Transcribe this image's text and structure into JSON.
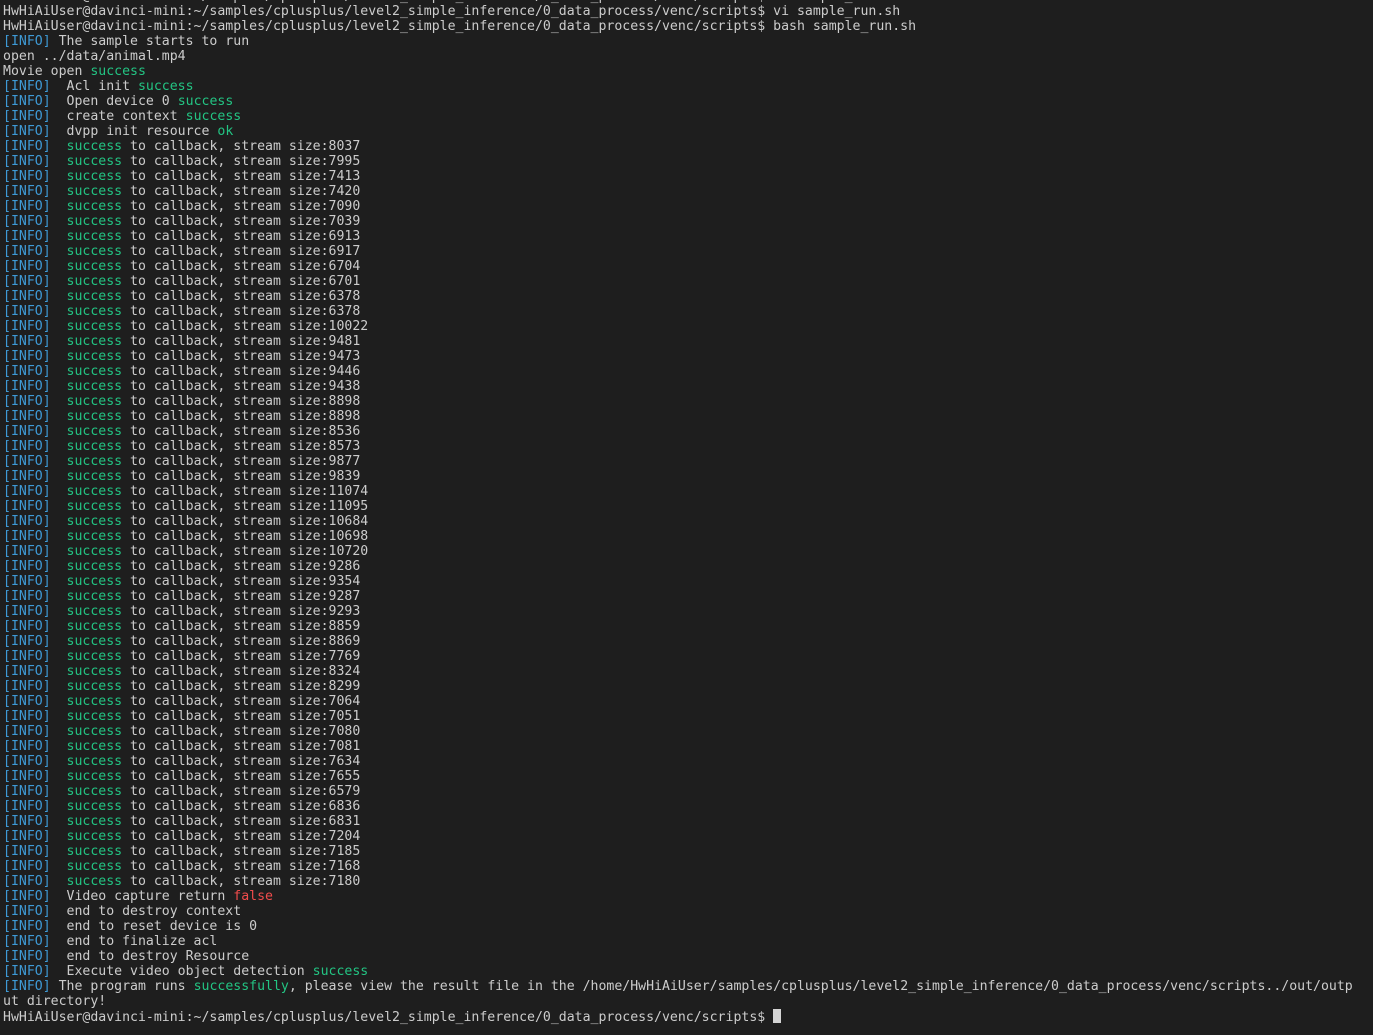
{
  "terminal": {
    "prompt": "HwHiAiUser@davinci-mini:~/samples/cplusplus/level2_simple_inference/0_data_process/venc/scripts$",
    "lines": [
      [
        [
          "plain",
          "HwHiAiUser@davinci-mini:~/samples/cplusplus/level2_simple_inference/0_data_process/venc/scripts$ vi sample_run.sh"
        ]
      ],
      [
        [
          "plain",
          "HwHiAiUser@davinci-mini:~/samples/cplusplus/level2_simple_inference/0_data_process/venc/scripts$ vi sample_run.sh"
        ]
      ],
      [
        [
          "plain",
          "HwHiAiUser@davinci-mini:~/samples/cplusplus/level2_simple_inference/0_data_process/venc/scripts$ bash sample_run.sh"
        ]
      ],
      [
        [
          "tag",
          "[INFO]"
        ],
        [
          "plain",
          " The sample starts to run"
        ]
      ],
      [
        [
          "plain",
          "open ../data/animal.mp4"
        ]
      ],
      [
        [
          "plain",
          "Movie open "
        ],
        [
          "ok",
          "success"
        ]
      ],
      [
        [
          "tag",
          "[INFO]"
        ],
        [
          "plain",
          "  Acl init "
        ],
        [
          "ok",
          "success"
        ]
      ],
      [
        [
          "tag",
          "[INFO]"
        ],
        [
          "plain",
          "  Open device 0 "
        ],
        [
          "ok",
          "success"
        ]
      ],
      [
        [
          "tag",
          "[INFO]"
        ],
        [
          "plain",
          "  create context "
        ],
        [
          "ok",
          "success"
        ]
      ],
      [
        [
          "tag",
          "[INFO]"
        ],
        [
          "plain",
          "  dvpp init resource "
        ],
        [
          "ok",
          "ok"
        ]
      ],
      [
        [
          "tag",
          "[INFO]"
        ],
        [
          "plain",
          "  "
        ],
        [
          "ok",
          "success"
        ],
        [
          "plain",
          " to callback, stream size:8037"
        ]
      ],
      [
        [
          "tag",
          "[INFO]"
        ],
        [
          "plain",
          "  "
        ],
        [
          "ok",
          "success"
        ],
        [
          "plain",
          " to callback, stream size:7995"
        ]
      ],
      [
        [
          "tag",
          "[INFO]"
        ],
        [
          "plain",
          "  "
        ],
        [
          "ok",
          "success"
        ],
        [
          "plain",
          " to callback, stream size:7413"
        ]
      ],
      [
        [
          "tag",
          "[INFO]"
        ],
        [
          "plain",
          "  "
        ],
        [
          "ok",
          "success"
        ],
        [
          "plain",
          " to callback, stream size:7420"
        ]
      ],
      [
        [
          "tag",
          "[INFO]"
        ],
        [
          "plain",
          "  "
        ],
        [
          "ok",
          "success"
        ],
        [
          "plain",
          " to callback, stream size:7090"
        ]
      ],
      [
        [
          "tag",
          "[INFO]"
        ],
        [
          "plain",
          "  "
        ],
        [
          "ok",
          "success"
        ],
        [
          "plain",
          " to callback, stream size:7039"
        ]
      ],
      [
        [
          "tag",
          "[INFO]"
        ],
        [
          "plain",
          "  "
        ],
        [
          "ok",
          "success"
        ],
        [
          "plain",
          " to callback, stream size:6913"
        ]
      ],
      [
        [
          "tag",
          "[INFO]"
        ],
        [
          "plain",
          "  "
        ],
        [
          "ok",
          "success"
        ],
        [
          "plain",
          " to callback, stream size:6917"
        ]
      ],
      [
        [
          "tag",
          "[INFO]"
        ],
        [
          "plain",
          "  "
        ],
        [
          "ok",
          "success"
        ],
        [
          "plain",
          " to callback, stream size:6704"
        ]
      ],
      [
        [
          "tag",
          "[INFO]"
        ],
        [
          "plain",
          "  "
        ],
        [
          "ok",
          "success"
        ],
        [
          "plain",
          " to callback, stream size:6701"
        ]
      ],
      [
        [
          "tag",
          "[INFO]"
        ],
        [
          "plain",
          "  "
        ],
        [
          "ok",
          "success"
        ],
        [
          "plain",
          " to callback, stream size:6378"
        ]
      ],
      [
        [
          "tag",
          "[INFO]"
        ],
        [
          "plain",
          "  "
        ],
        [
          "ok",
          "success"
        ],
        [
          "plain",
          " to callback, stream size:6378"
        ]
      ],
      [
        [
          "tag",
          "[INFO]"
        ],
        [
          "plain",
          "  "
        ],
        [
          "ok",
          "success"
        ],
        [
          "plain",
          " to callback, stream size:10022"
        ]
      ],
      [
        [
          "tag",
          "[INFO]"
        ],
        [
          "plain",
          "  "
        ],
        [
          "ok",
          "success"
        ],
        [
          "plain",
          " to callback, stream size:9481"
        ]
      ],
      [
        [
          "tag",
          "[INFO]"
        ],
        [
          "plain",
          "  "
        ],
        [
          "ok",
          "success"
        ],
        [
          "plain",
          " to callback, stream size:9473"
        ]
      ],
      [
        [
          "tag",
          "[INFO]"
        ],
        [
          "plain",
          "  "
        ],
        [
          "ok",
          "success"
        ],
        [
          "plain",
          " to callback, stream size:9446"
        ]
      ],
      [
        [
          "tag",
          "[INFO]"
        ],
        [
          "plain",
          "  "
        ],
        [
          "ok",
          "success"
        ],
        [
          "plain",
          " to callback, stream size:9438"
        ]
      ],
      [
        [
          "tag",
          "[INFO]"
        ],
        [
          "plain",
          "  "
        ],
        [
          "ok",
          "success"
        ],
        [
          "plain",
          " to callback, stream size:8898"
        ]
      ],
      [
        [
          "tag",
          "[INFO]"
        ],
        [
          "plain",
          "  "
        ],
        [
          "ok",
          "success"
        ],
        [
          "plain",
          " to callback, stream size:8898"
        ]
      ],
      [
        [
          "tag",
          "[INFO]"
        ],
        [
          "plain",
          "  "
        ],
        [
          "ok",
          "success"
        ],
        [
          "plain",
          " to callback, stream size:8536"
        ]
      ],
      [
        [
          "tag",
          "[INFO]"
        ],
        [
          "plain",
          "  "
        ],
        [
          "ok",
          "success"
        ],
        [
          "plain",
          " to callback, stream size:8573"
        ]
      ],
      [
        [
          "tag",
          "[INFO]"
        ],
        [
          "plain",
          "  "
        ],
        [
          "ok",
          "success"
        ],
        [
          "plain",
          " to callback, stream size:9877"
        ]
      ],
      [
        [
          "tag",
          "[INFO]"
        ],
        [
          "plain",
          "  "
        ],
        [
          "ok",
          "success"
        ],
        [
          "plain",
          " to callback, stream size:9839"
        ]
      ],
      [
        [
          "tag",
          "[INFO]"
        ],
        [
          "plain",
          "  "
        ],
        [
          "ok",
          "success"
        ],
        [
          "plain",
          " to callback, stream size:11074"
        ]
      ],
      [
        [
          "tag",
          "[INFO]"
        ],
        [
          "plain",
          "  "
        ],
        [
          "ok",
          "success"
        ],
        [
          "plain",
          " to callback, stream size:11095"
        ]
      ],
      [
        [
          "tag",
          "[INFO]"
        ],
        [
          "plain",
          "  "
        ],
        [
          "ok",
          "success"
        ],
        [
          "plain",
          " to callback, stream size:10684"
        ]
      ],
      [
        [
          "tag",
          "[INFO]"
        ],
        [
          "plain",
          "  "
        ],
        [
          "ok",
          "success"
        ],
        [
          "plain",
          " to callback, stream size:10698"
        ]
      ],
      [
        [
          "tag",
          "[INFO]"
        ],
        [
          "plain",
          "  "
        ],
        [
          "ok",
          "success"
        ],
        [
          "plain",
          " to callback, stream size:10720"
        ]
      ],
      [
        [
          "tag",
          "[INFO]"
        ],
        [
          "plain",
          "  "
        ],
        [
          "ok",
          "success"
        ],
        [
          "plain",
          " to callback, stream size:9286"
        ]
      ],
      [
        [
          "tag",
          "[INFO]"
        ],
        [
          "plain",
          "  "
        ],
        [
          "ok",
          "success"
        ],
        [
          "plain",
          " to callback, stream size:9354"
        ]
      ],
      [
        [
          "tag",
          "[INFO]"
        ],
        [
          "plain",
          "  "
        ],
        [
          "ok",
          "success"
        ],
        [
          "plain",
          " to callback, stream size:9287"
        ]
      ],
      [
        [
          "tag",
          "[INFO]"
        ],
        [
          "plain",
          "  "
        ],
        [
          "ok",
          "success"
        ],
        [
          "plain",
          " to callback, stream size:9293"
        ]
      ],
      [
        [
          "tag",
          "[INFO]"
        ],
        [
          "plain",
          "  "
        ],
        [
          "ok",
          "success"
        ],
        [
          "plain",
          " to callback, stream size:8859"
        ]
      ],
      [
        [
          "tag",
          "[INFO]"
        ],
        [
          "plain",
          "  "
        ],
        [
          "ok",
          "success"
        ],
        [
          "plain",
          " to callback, stream size:8869"
        ]
      ],
      [
        [
          "tag",
          "[INFO]"
        ],
        [
          "plain",
          "  "
        ],
        [
          "ok",
          "success"
        ],
        [
          "plain",
          " to callback, stream size:7769"
        ]
      ],
      [
        [
          "tag",
          "[INFO]"
        ],
        [
          "plain",
          "  "
        ],
        [
          "ok",
          "success"
        ],
        [
          "plain",
          " to callback, stream size:8324"
        ]
      ],
      [
        [
          "tag",
          "[INFO]"
        ],
        [
          "plain",
          "  "
        ],
        [
          "ok",
          "success"
        ],
        [
          "plain",
          " to callback, stream size:8299"
        ]
      ],
      [
        [
          "tag",
          "[INFO]"
        ],
        [
          "plain",
          "  "
        ],
        [
          "ok",
          "success"
        ],
        [
          "plain",
          " to callback, stream size:7064"
        ]
      ],
      [
        [
          "tag",
          "[INFO]"
        ],
        [
          "plain",
          "  "
        ],
        [
          "ok",
          "success"
        ],
        [
          "plain",
          " to callback, stream size:7051"
        ]
      ],
      [
        [
          "tag",
          "[INFO]"
        ],
        [
          "plain",
          "  "
        ],
        [
          "ok",
          "success"
        ],
        [
          "plain",
          " to callback, stream size:7080"
        ]
      ],
      [
        [
          "tag",
          "[INFO]"
        ],
        [
          "plain",
          "  "
        ],
        [
          "ok",
          "success"
        ],
        [
          "plain",
          " to callback, stream size:7081"
        ]
      ],
      [
        [
          "tag",
          "[INFO]"
        ],
        [
          "plain",
          "  "
        ],
        [
          "ok",
          "success"
        ],
        [
          "plain",
          " to callback, stream size:7634"
        ]
      ],
      [
        [
          "tag",
          "[INFO]"
        ],
        [
          "plain",
          "  "
        ],
        [
          "ok",
          "success"
        ],
        [
          "plain",
          " to callback, stream size:7655"
        ]
      ],
      [
        [
          "tag",
          "[INFO]"
        ],
        [
          "plain",
          "  "
        ],
        [
          "ok",
          "success"
        ],
        [
          "plain",
          " to callback, stream size:6579"
        ]
      ],
      [
        [
          "tag",
          "[INFO]"
        ],
        [
          "plain",
          "  "
        ],
        [
          "ok",
          "success"
        ],
        [
          "plain",
          " to callback, stream size:6836"
        ]
      ],
      [
        [
          "tag",
          "[INFO]"
        ],
        [
          "plain",
          "  "
        ],
        [
          "ok",
          "success"
        ],
        [
          "plain",
          " to callback, stream size:6831"
        ]
      ],
      [
        [
          "tag",
          "[INFO]"
        ],
        [
          "plain",
          "  "
        ],
        [
          "ok",
          "success"
        ],
        [
          "plain",
          " to callback, stream size:7204"
        ]
      ],
      [
        [
          "tag",
          "[INFO]"
        ],
        [
          "plain",
          "  "
        ],
        [
          "ok",
          "success"
        ],
        [
          "plain",
          " to callback, stream size:7185"
        ]
      ],
      [
        [
          "tag",
          "[INFO]"
        ],
        [
          "plain",
          "  "
        ],
        [
          "ok",
          "success"
        ],
        [
          "plain",
          " to callback, stream size:7168"
        ]
      ],
      [
        [
          "tag",
          "[INFO]"
        ],
        [
          "plain",
          "  "
        ],
        [
          "ok",
          "success"
        ],
        [
          "plain",
          " to callback, stream size:7180"
        ]
      ],
      [
        [
          "tag",
          "[INFO]"
        ],
        [
          "plain",
          "  Video capture return "
        ],
        [
          "err",
          "false"
        ]
      ],
      [
        [
          "tag",
          "[INFO]"
        ],
        [
          "plain",
          "  end to destroy context"
        ]
      ],
      [
        [
          "tag",
          "[INFO]"
        ],
        [
          "plain",
          "  end to reset device is 0"
        ]
      ],
      [
        [
          "tag",
          "[INFO]"
        ],
        [
          "plain",
          "  end to finalize acl"
        ]
      ],
      [
        [
          "tag",
          "[INFO]"
        ],
        [
          "plain",
          "  end to destroy Resource"
        ]
      ],
      [
        [
          "tag",
          "[INFO]"
        ],
        [
          "plain",
          "  Execute video object detection "
        ],
        [
          "ok",
          "success"
        ]
      ],
      [
        [
          "tag",
          "[INFO]"
        ],
        [
          "plain",
          " The program runs "
        ],
        [
          "ok",
          "successfully"
        ],
        [
          "plain",
          ", please view the result file in the /home/HwHiAiUser/samples/cplusplus/level2_simple_inference/0_data_process/venc/scripts../out/outp"
        ]
      ],
      [
        [
          "plain",
          "ut directory!"
        ]
      ]
    ]
  },
  "colors": {
    "background": "#1e1e1e",
    "text": "#cccccc",
    "info_tag": "#3e9ad6",
    "success": "#23c483",
    "error": "#f14c4c"
  }
}
